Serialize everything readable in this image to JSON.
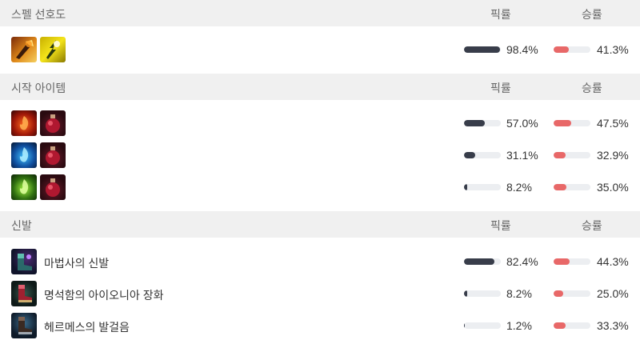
{
  "spells": {
    "title": "스펠 선호도",
    "pick_header": "픽률",
    "win_header": "승률",
    "rows": [
      {
        "icons": [
          "ignite-spell-icon",
          "flash-spell-icon"
        ],
        "pick": "98.4%",
        "pick_value": 98.4,
        "win": "41.3%",
        "win_value": 41.3
      }
    ]
  },
  "start_items": {
    "title": "시작 아이템",
    "pick_header": "픽률",
    "win_header": "승률",
    "rows": [
      {
        "icons": [
          "red-support-item-icon",
          "health-potion-icon"
        ],
        "pick": "57.0%",
        "pick_value": 57.0,
        "win": "47.5%",
        "win_value": 47.5
      },
      {
        "icons": [
          "blue-support-item-icon",
          "health-potion-icon"
        ],
        "pick": "31.1%",
        "pick_value": 31.1,
        "win": "32.9%",
        "win_value": 32.9
      },
      {
        "icons": [
          "green-support-item-icon",
          "health-potion-icon"
        ],
        "pick": "8.2%",
        "pick_value": 8.2,
        "win": "35.0%",
        "win_value": 35.0
      }
    ]
  },
  "boots": {
    "title": "신발",
    "pick_header": "픽률",
    "win_header": "승률",
    "rows": [
      {
        "icon": "sorcerer-shoes-icon",
        "name": "마법사의 신발",
        "pick": "82.4%",
        "pick_value": 82.4,
        "win": "44.3%",
        "win_value": 44.3
      },
      {
        "icon": "ionian-boots-icon",
        "name": "명석함의 아이오니아 장화",
        "pick": "8.2%",
        "pick_value": 8.2,
        "win": "25.0%",
        "win_value": 25.0
      },
      {
        "icon": "mercury-treads-icon",
        "name": "헤르메스의 발걸음",
        "pick": "1.2%",
        "pick_value": 1.2,
        "win": "33.3%",
        "win_value": 33.3
      }
    ]
  },
  "colors": {
    "pick_bar": "#383d4a",
    "win_bar": "#e86868",
    "track": "#eceef1",
    "header_bg": "#f0f0f0"
  }
}
